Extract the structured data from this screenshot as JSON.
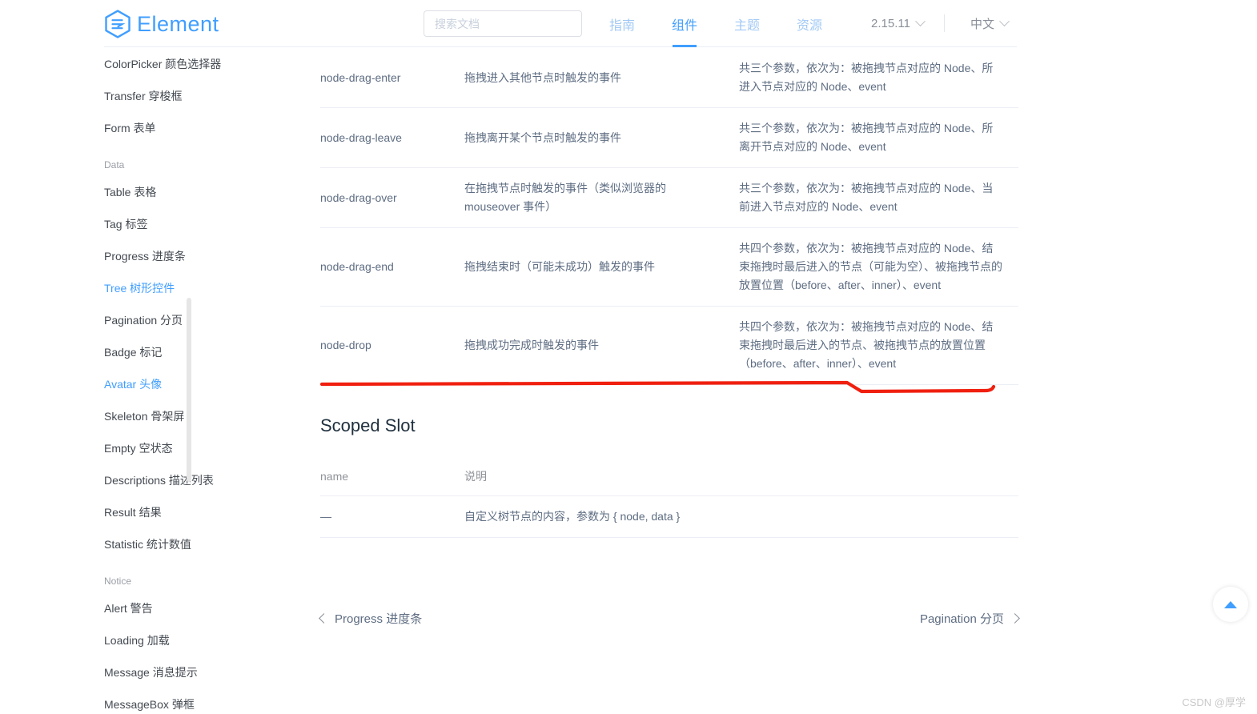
{
  "header": {
    "logo_text": "Element",
    "logo_icon": "element-hexagon-logo-icon",
    "search": {
      "placeholder": "搜索文档",
      "value": "",
      "icon": "search-input"
    },
    "nav": [
      {
        "label": "指南",
        "active": false
      },
      {
        "label": "组件",
        "active": true
      },
      {
        "label": "主题",
        "active": false
      },
      {
        "label": "资源",
        "active": false
      }
    ],
    "version": {
      "label": "2.15.11",
      "caret": "chevron-down-icon"
    },
    "language": {
      "label": "中文",
      "caret": "chevron-down-icon"
    },
    "accent_color": "#409eff",
    "nav_inactive_color": "#a2c9f5"
  },
  "sidebar": {
    "items": [
      {
        "type": "link",
        "label": "ColorPicker 颜色选择器",
        "active": false
      },
      {
        "type": "link",
        "label": "Transfer 穿梭框",
        "active": false
      },
      {
        "type": "link",
        "label": "Form 表单",
        "active": false
      },
      {
        "type": "group",
        "label": "Data"
      },
      {
        "type": "link",
        "label": "Table 表格",
        "active": false
      },
      {
        "type": "link",
        "label": "Tag 标签",
        "active": false
      },
      {
        "type": "link",
        "label": "Progress 进度条",
        "active": false
      },
      {
        "type": "link",
        "label": "Tree 树形控件",
        "active": true
      },
      {
        "type": "link",
        "label": "Pagination 分页",
        "active": false
      },
      {
        "type": "link",
        "label": "Badge 标记",
        "active": false
      },
      {
        "type": "link",
        "label": "Avatar 头像",
        "active": true
      },
      {
        "type": "link",
        "label": "Skeleton 骨架屏",
        "active": false
      },
      {
        "type": "link",
        "label": "Empty 空状态",
        "active": false
      },
      {
        "type": "link",
        "label": "Descriptions 描述列表",
        "active": false
      },
      {
        "type": "link",
        "label": "Result 结果",
        "active": false
      },
      {
        "type": "link",
        "label": "Statistic 统计数值",
        "active": false
      },
      {
        "type": "group",
        "label": "Notice"
      },
      {
        "type": "link",
        "label": "Alert 警告",
        "active": false
      },
      {
        "type": "link",
        "label": "Loading 加载",
        "active": false
      },
      {
        "type": "link",
        "label": "Message 消息提示",
        "active": false
      },
      {
        "type": "link",
        "label": "MessageBox 弹框",
        "active": false
      }
    ]
  },
  "main": {
    "events_table": {
      "rows": [
        {
          "name": "node-drag-enter",
          "desc": "拖拽进入其他节点时触发的事件",
          "params": "共三个参数，依次为：被拖拽节点对应的 Node、所进入节点对应的 Node、event"
        },
        {
          "name": "node-drag-leave",
          "desc": "拖拽离开某个节点时触发的事件",
          "params": "共三个参数，依次为：被拖拽节点对应的 Node、所离开节点对应的 Node、event"
        },
        {
          "name": "node-drag-over",
          "desc": "在拖拽节点时触发的事件（类似浏览器的 mouseover 事件）",
          "params": "共三个参数，依次为：被拖拽节点对应的 Node、当前进入节点对应的 Node、event"
        },
        {
          "name": "node-drag-end",
          "desc": "拖拽结束时（可能未成功）触发的事件",
          "params": "共四个参数，依次为：被拖拽节点对应的 Node、结束拖拽时最后进入的节点（可能为空）、被拖拽节点的放置位置（before、after、inner）、event"
        },
        {
          "name": "node-drop",
          "desc": "拖拽成功完成时触发的事件",
          "params": "共四个参数，依次为：被拖拽节点对应的 Node、结束拖拽时最后进入的节点、被拖拽节点的放置位置（before、after、inner）、event"
        }
      ]
    },
    "scoped_slot": {
      "title": "Scoped Slot",
      "columns": [
        "name",
        "说明"
      ],
      "rows": [
        {
          "name": "—",
          "desc": "自定义树节点的内容，参数为 { node, data }"
        }
      ]
    },
    "annotation": {
      "type": "hand-drawn-underline",
      "color": "#f01f0f"
    }
  },
  "footer_nav": {
    "prev": {
      "label": "Progress 进度条",
      "icon": "chevron-left-icon"
    },
    "next": {
      "label": "Pagination 分页",
      "icon": "chevron-right-icon"
    }
  },
  "back_to_top": {
    "icon": "triangle-up-icon",
    "label": ""
  },
  "watermark": {
    "text": "CSDN @厚学"
  }
}
